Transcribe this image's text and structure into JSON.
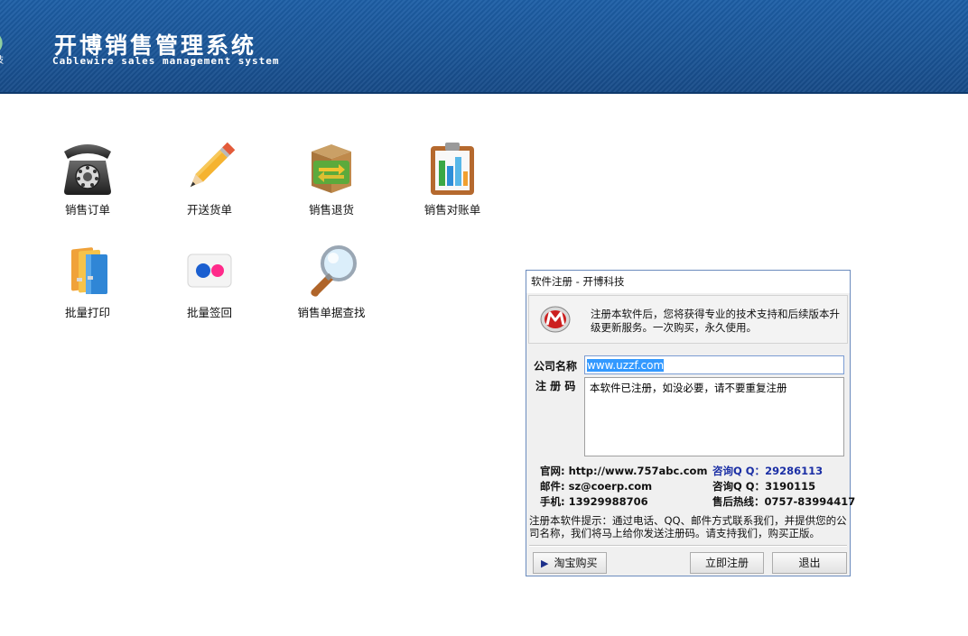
{
  "header": {
    "title": "开博销售管理系统",
    "subtitle": "Cablewire sales management system",
    "logo_fragment": "技"
  },
  "modules": [
    {
      "label": "销售订单",
      "icon": "telephone-icon"
    },
    {
      "label": "开送货单",
      "icon": "pencil-icon"
    },
    {
      "label": "销售退货",
      "icon": "return-box-icon"
    },
    {
      "label": "销售对账单",
      "icon": "clipboard-chart-icon"
    },
    {
      "label": "批量打印",
      "icon": "folders-icon"
    },
    {
      "label": "批量签回",
      "icon": "flickr-dots-icon"
    },
    {
      "label": "销售单据查找",
      "icon": "magnifier-icon"
    }
  ],
  "dialog": {
    "title": "软件注册 - 开博科技",
    "info_text": "注册本软件后，您将获得专业的技术支持和后续版本升级更新服务。一次购买，永久使用。",
    "company_label": "公司名称",
    "company_value": "www.uzzf.com",
    "regcode_label": "注 册 码",
    "regcode_value": "本软件已注册，如没必要，请不要重复注册",
    "contacts": {
      "website_label": "官网:",
      "website_value": "http://www.757abc.com",
      "email_label": "邮件:",
      "email_value": "sz@coerp.com",
      "mobile_label": "手机:",
      "mobile_value": "13929988706",
      "qq1_label": "咨询Q Q：",
      "qq1_value": "29286113",
      "qq2_label": "咨询Q Q：",
      "qq2_value": "3190115",
      "hotline_label": "售后热线：",
      "hotline_value": "0757-83994417"
    },
    "hint_text": "注册本软件提示：通过电话、QQ、邮件方式联系我们，并提供您的公司名称，我们将马上给你发送注册码。请支持我们，购买正版。",
    "buttons": {
      "taobao": "淘宝购买",
      "register": "立即注册",
      "exit": "退出"
    }
  },
  "colors": {
    "banner": "#1a5597",
    "qq_blue": "#1b2fa5",
    "selection": "#3399ff"
  }
}
